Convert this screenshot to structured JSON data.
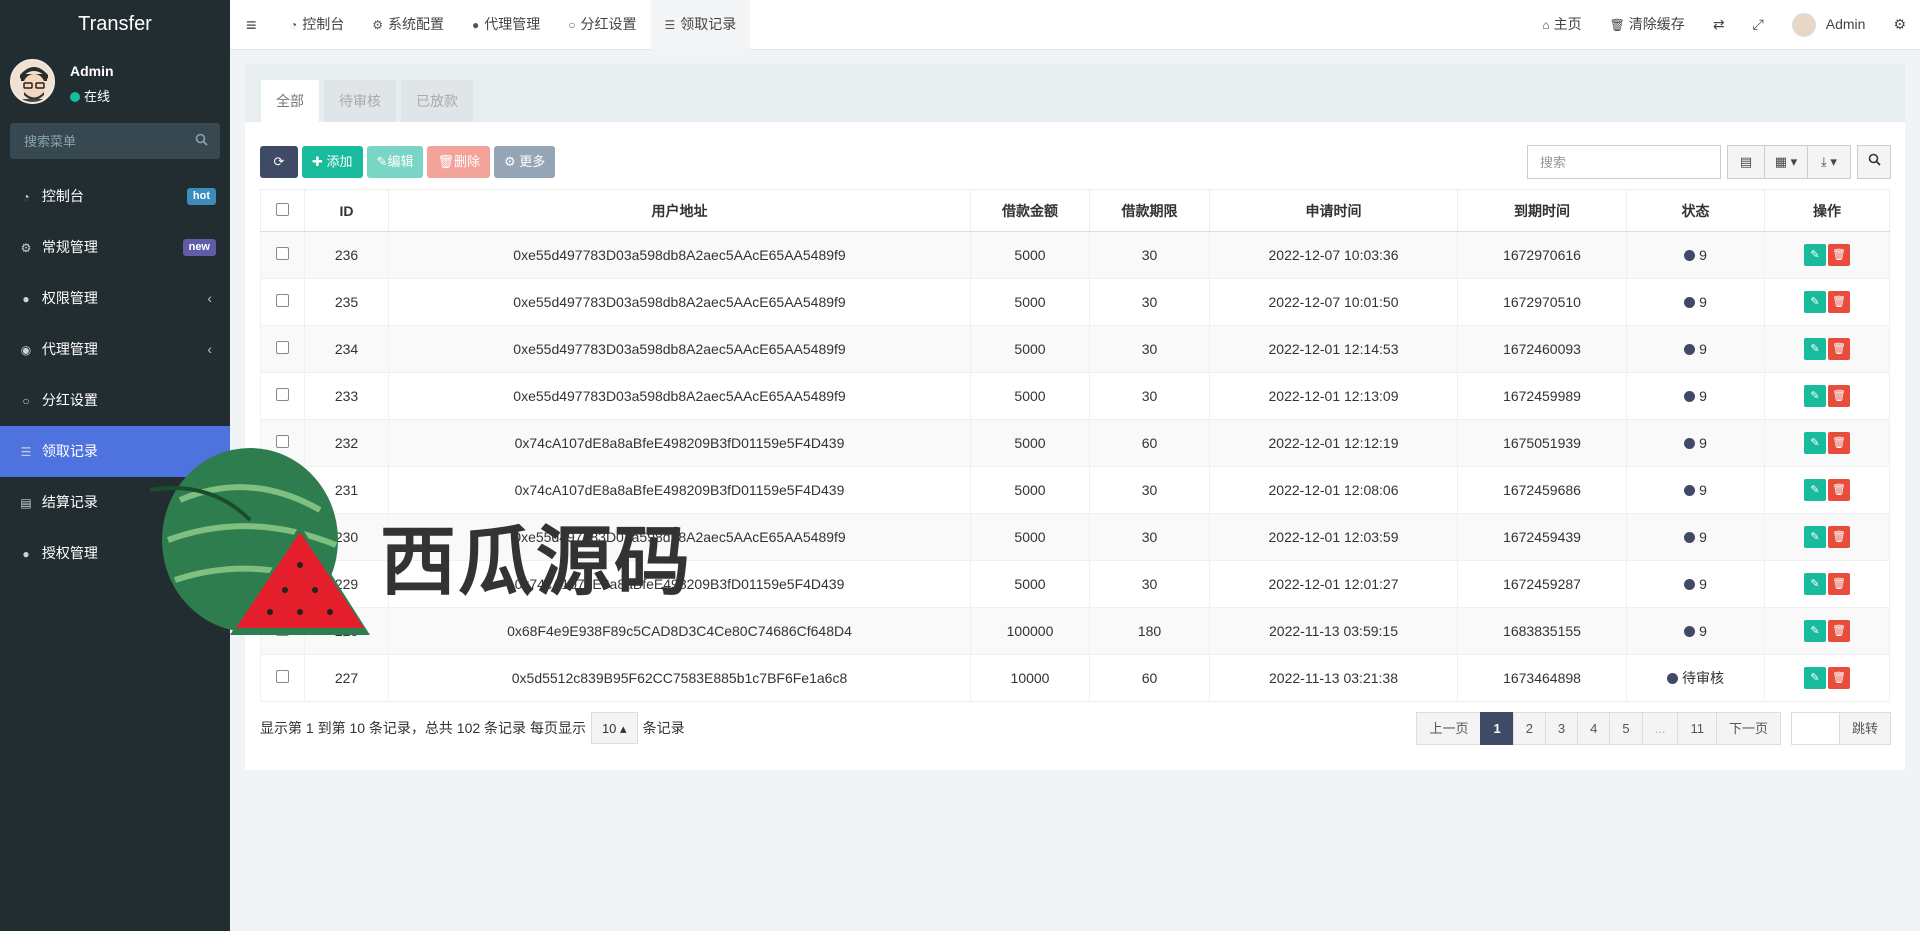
{
  "brand": "Transfer",
  "user": {
    "name": "Admin",
    "status": "在线"
  },
  "sidebar": {
    "search_placeholder": "搜索菜单",
    "items": [
      {
        "label": "控制台",
        "icon": "dashboard-icon",
        "badge": "hot"
      },
      {
        "label": "常规管理",
        "icon": "cogs-icon",
        "badge": "new"
      },
      {
        "label": "权限管理",
        "icon": "group-icon",
        "badge": ""
      },
      {
        "label": "代理管理",
        "icon": "user-circle-icon",
        "badge": ""
      },
      {
        "label": "分红设置",
        "icon": "circle-icon",
        "badge": ""
      },
      {
        "label": "领取记录",
        "icon": "list-icon",
        "badge": ""
      },
      {
        "label": "结算记录",
        "icon": "table-icon",
        "badge": ""
      },
      {
        "label": "授权管理",
        "icon": "group-icon",
        "badge": ""
      }
    ]
  },
  "topnav": {
    "tabs": [
      {
        "label": "控制台"
      },
      {
        "label": "系统配置"
      },
      {
        "label": "代理管理"
      },
      {
        "label": "分红设置"
      },
      {
        "label": "领取记录"
      }
    ],
    "home": "主页",
    "clear_cache": "清除缓存",
    "admin": "Admin"
  },
  "panel": {
    "tabs": [
      "全部",
      "待审核",
      "已放款"
    ],
    "toolbar": {
      "add": "添加",
      "edit": "编辑",
      "delete": "删除",
      "more": "更多"
    },
    "search_placeholder": "搜索"
  },
  "table": {
    "headers": [
      "ID",
      "用户地址",
      "借款金额",
      "借款期限",
      "申请时间",
      "到期时间",
      "状态",
      "操作"
    ],
    "rows": [
      {
        "id": "236",
        "address": "0xe55d497783D03a598db8A2aec5AAcE65AA5489f9",
        "amount": "5000",
        "term": "30",
        "apply_time": "2022-12-07 10:03:36",
        "due": "1672970616",
        "status": "9"
      },
      {
        "id": "235",
        "address": "0xe55d497783D03a598db8A2aec5AAcE65AA5489f9",
        "amount": "5000",
        "term": "30",
        "apply_time": "2022-12-07 10:01:50",
        "due": "1672970510",
        "status": "9"
      },
      {
        "id": "234",
        "address": "0xe55d497783D03a598db8A2aec5AAcE65AA5489f9",
        "amount": "5000",
        "term": "30",
        "apply_time": "2022-12-01 12:14:53",
        "due": "1672460093",
        "status": "9"
      },
      {
        "id": "233",
        "address": "0xe55d497783D03a598db8A2aec5AAcE65AA5489f9",
        "amount": "5000",
        "term": "30",
        "apply_time": "2022-12-01 12:13:09",
        "due": "1672459989",
        "status": "9"
      },
      {
        "id": "232",
        "address": "0x74cA107dE8a8aBfeE498209B3fD01159e5F4D439",
        "amount": "5000",
        "term": "60",
        "apply_time": "2022-12-01 12:12:19",
        "due": "1675051939",
        "status": "9"
      },
      {
        "id": "231",
        "address": "0x74cA107dE8a8aBfeE498209B3fD01159e5F4D439",
        "amount": "5000",
        "term": "30",
        "apply_time": "2022-12-01 12:08:06",
        "due": "1672459686",
        "status": "9"
      },
      {
        "id": "230",
        "address": "0xe55d497783D03a598db8A2aec5AAcE65AA5489f9",
        "amount": "5000",
        "term": "30",
        "apply_time": "2022-12-01 12:03:59",
        "due": "1672459439",
        "status": "9"
      },
      {
        "id": "229",
        "address": "0x74cA107dE8a8aBfeE498209B3fD01159e5F4D439",
        "amount": "5000",
        "term": "30",
        "apply_time": "2022-12-01 12:01:27",
        "due": "1672459287",
        "status": "9"
      },
      {
        "id": "228",
        "address": "0x68F4e9E938F89c5CAD8D3C4Ce80C74686Cf648D4",
        "amount": "100000",
        "term": "180",
        "apply_time": "2022-11-13 03:59:15",
        "due": "1683835155",
        "status": "9"
      },
      {
        "id": "227",
        "address": "0x5d5512c839B95F62CC7583E885b1c7BF6Fe1a6c8",
        "amount": "10000",
        "term": "60",
        "apply_time": "2022-11-13 03:21:38",
        "due": "1673464898",
        "status": "待审核"
      }
    ]
  },
  "footer": {
    "info_prefix": "显示第 1 到第 10 条记录，总共 102 条记录 每页显示",
    "page_size": "10",
    "info_suffix": "条记录"
  },
  "pager": {
    "prev": "上一页",
    "pages": [
      "1",
      "2",
      "3",
      "4",
      "5",
      "...",
      "11"
    ],
    "active": "1",
    "next": "下一页",
    "go": "跳转"
  },
  "watermark": "西瓜源码"
}
